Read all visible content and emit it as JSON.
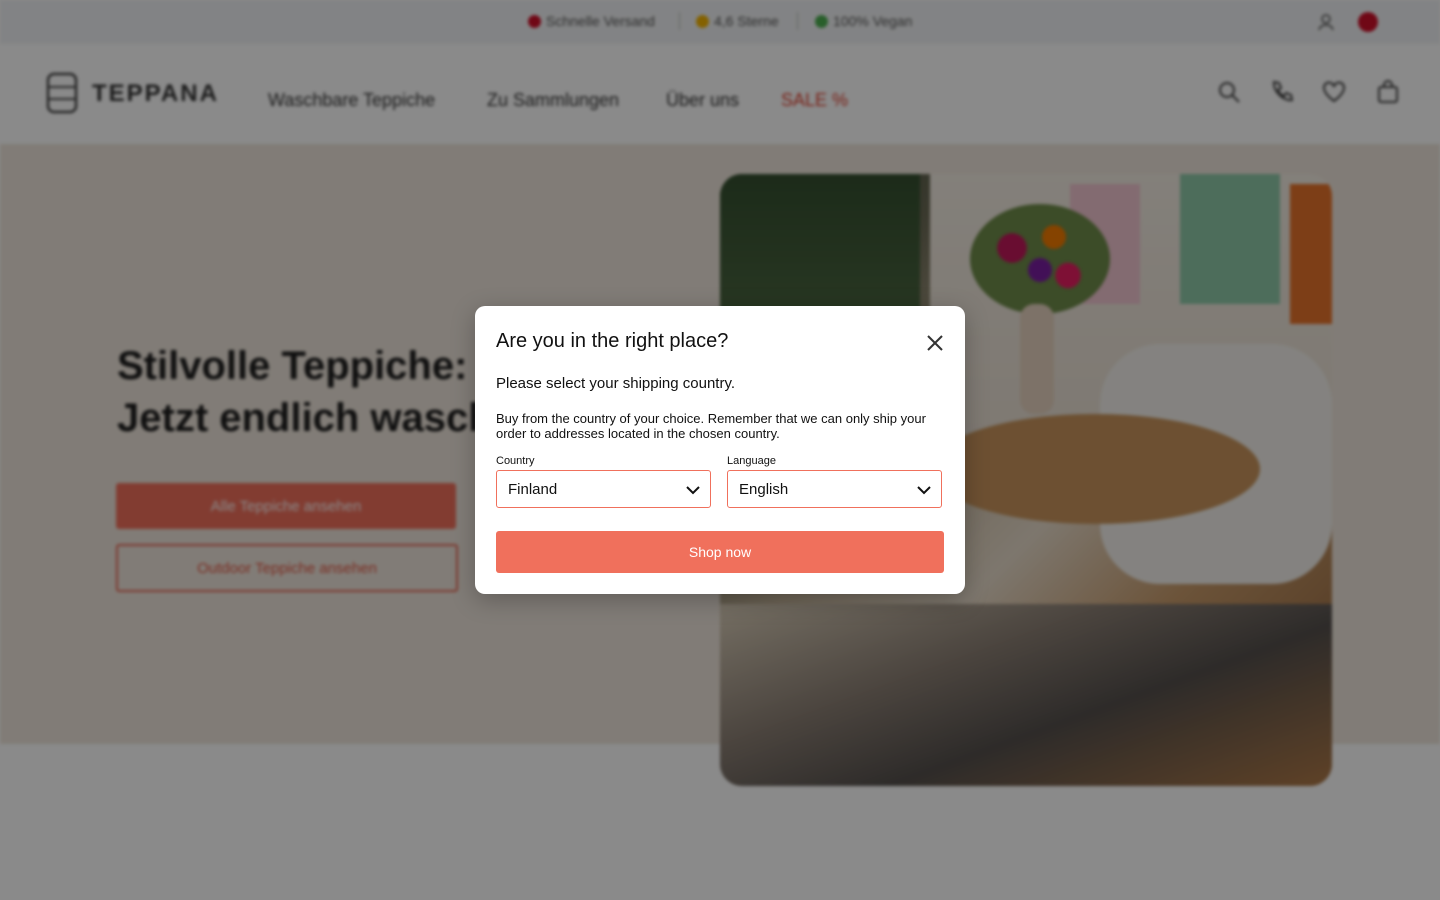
{
  "topbar": {
    "usps": [
      {
        "icon": "shipping-icon",
        "text": "Schnelle Versand",
        "color": "#d0102a"
      },
      {
        "icon": "star-icon",
        "text": "4,6 Sterne",
        "color": "#f4b400"
      },
      {
        "icon": "leaf-icon",
        "text": "100% Vegan",
        "color": "#4caf50"
      }
    ],
    "account_icon": "user-icon",
    "flag_icon": "country-flag-icon"
  },
  "header": {
    "logo_text": "TEPPANA",
    "nav": [
      "Waschbare Teppiche",
      "Zu Sammlungen",
      "Über uns",
      "SALE %"
    ],
    "icons": [
      "search-icon",
      "phone-icon",
      "heart-icon",
      "cart-icon"
    ]
  },
  "hero": {
    "title_line1": "Stilvolle Teppiche:",
    "title_line2": "Jetzt endlich waschbar",
    "button_primary": "Alle Teppiche ansehen",
    "button_secondary": "Outdoor Teppiche ansehen"
  },
  "modal": {
    "title": "Are you in the right place?",
    "subtitle": "Please select your shipping country.",
    "info": "Buy from the country of your choice. Remember that we can only ship your order to addresses located in the chosen country.",
    "country_label": "Country",
    "country_value": "Finland",
    "language_label": "Language",
    "language_value": "English",
    "button": "Shop now"
  },
  "colors": {
    "accent": "#f0705c",
    "sale": "#e03c2a"
  }
}
